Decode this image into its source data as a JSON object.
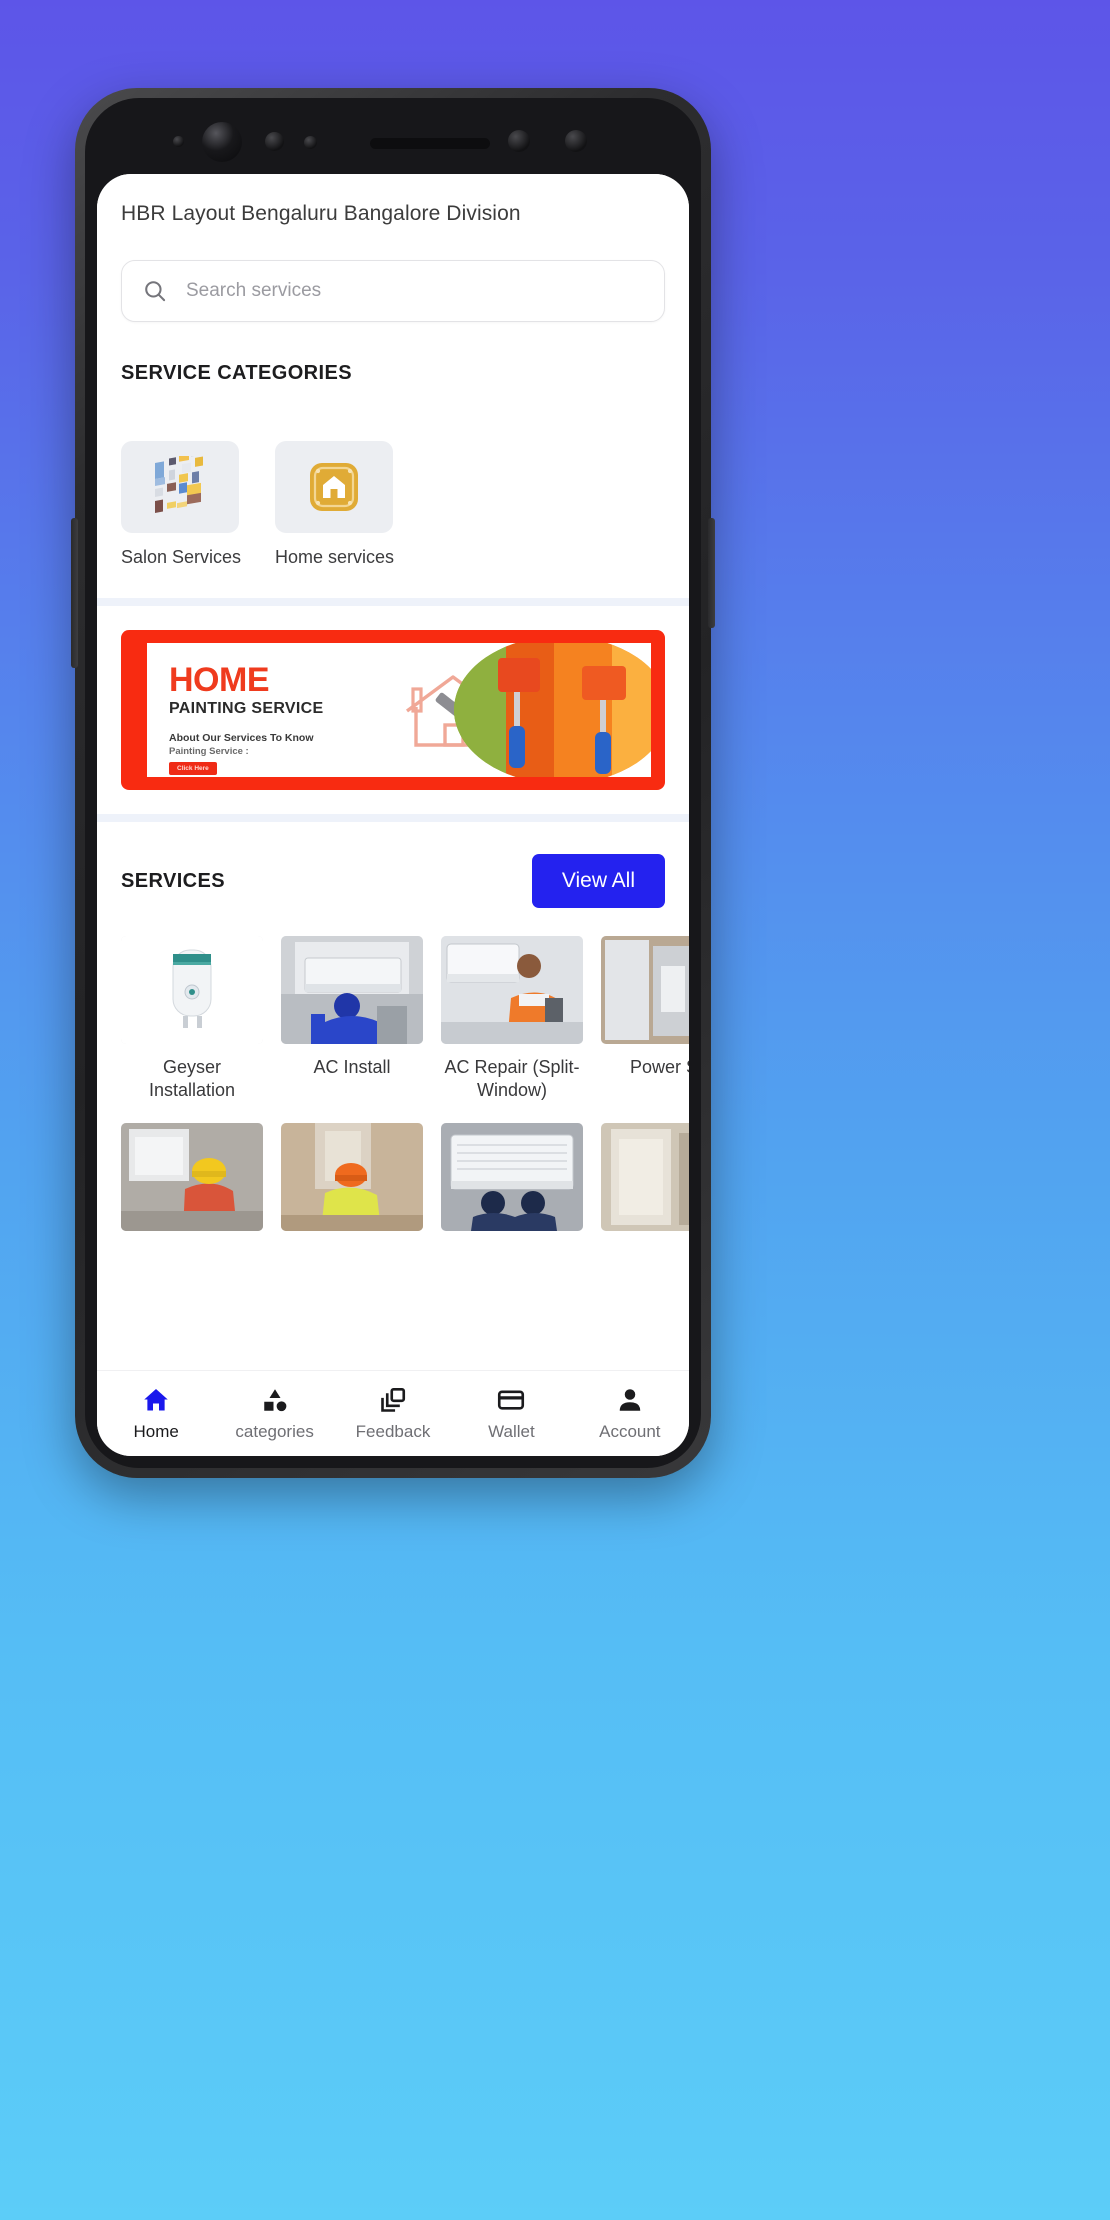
{
  "device": {
    "frame_color": "#2d2d2f",
    "sensors": [
      "proximity-dot",
      "front-camera",
      "sensor-dot",
      "sensor-dot",
      "earpiece-speaker",
      "sensor-dot",
      "sensor-dot"
    ]
  },
  "background": {
    "gradient_top": "#5d55e8",
    "gradient_bottom": "#5ccdf8"
  },
  "header": {
    "location_title": "HBR Layout Bengaluru Bangalore Division"
  },
  "search": {
    "placeholder": "Search services",
    "value": "",
    "icon": "search-icon"
  },
  "categories_section": {
    "title": "SERVICE CATEGORIES",
    "items": [
      {
        "label": "Salon Services",
        "icon": "salon-isometric-illustration"
      },
      {
        "label": "Home services",
        "icon": "home-services-amber-icon"
      }
    ]
  },
  "banner": {
    "title": "HOME",
    "subtitle": "PAINTING SERVICE",
    "line1": "About Our Services To Know",
    "line2": "Painting Service :",
    "cta": "Click Here",
    "border_color": "#f82b11",
    "title_color": "#ef3b1e",
    "icon": "house-paint-roller-icon"
  },
  "services_section": {
    "title": "SERVICES",
    "view_all_label": "View All",
    "view_all_color": "#2422ef",
    "row1": [
      {
        "name": "Geyser Installation",
        "image": "geyser-water-heater-photo"
      },
      {
        "name": "AC Install",
        "image": "ac-installation-technician-photo"
      },
      {
        "name": "AC Repair (Split-Window)",
        "image": "ac-repair-technician-photo"
      },
      {
        "name": "Power Ser",
        "image": "power-service-photo"
      }
    ],
    "row2": [
      {
        "image": "electrician-yellow-helmet-photo"
      },
      {
        "image": "plumber-orange-helmet-photo"
      },
      {
        "image": "ac-servicing-two-technicians-photo"
      },
      {
        "image": "appliance-repair-photo"
      }
    ]
  },
  "bottom_nav": {
    "active_color": "#1a18ec",
    "items": [
      {
        "label": "Home",
        "icon": "home-icon",
        "active": true
      },
      {
        "label": "categories",
        "icon": "category-shapes-icon",
        "active": false
      },
      {
        "label": "Feedback",
        "icon": "layers-feedback-icon",
        "active": false
      },
      {
        "label": "Wallet",
        "icon": "wallet-card-icon",
        "active": false
      },
      {
        "label": "Account",
        "icon": "person-account-icon",
        "active": false
      }
    ]
  }
}
